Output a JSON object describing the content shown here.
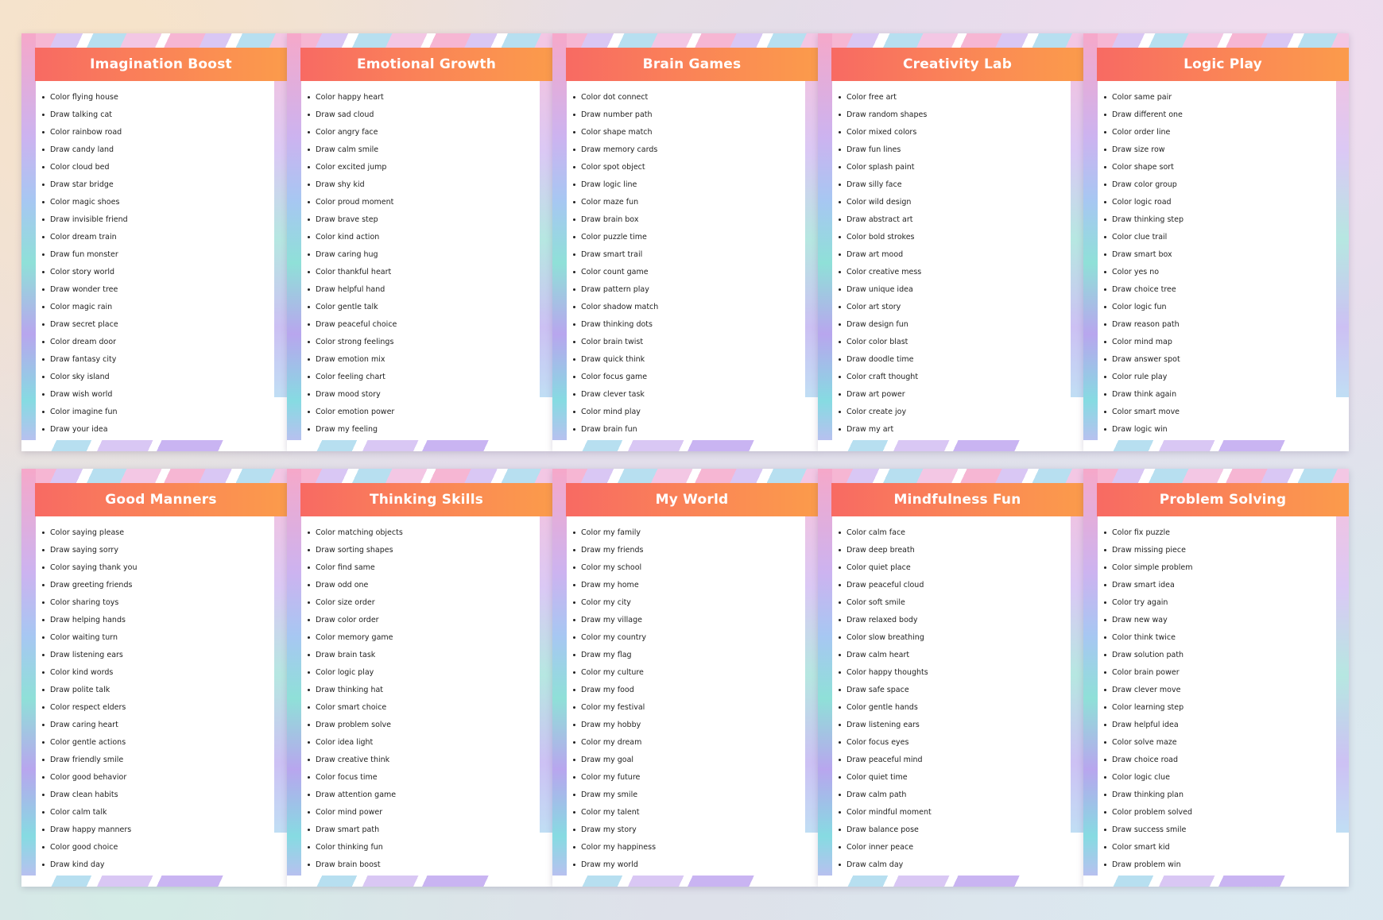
{
  "pages": [
    {
      "title": "Imagination Boost",
      "items": [
        "Color flying house",
        "Draw talking cat",
        "Color rainbow road",
        "Draw candy land",
        "Color cloud bed",
        "Draw star bridge",
        "Color magic shoes",
        "Draw invisible friend",
        "Color dream train",
        "Draw fun monster",
        "Color story world",
        "Draw wonder tree",
        "Color magic rain",
        "Draw secret place",
        "Color dream door",
        "Draw fantasy city",
        "Color sky island",
        "Draw wish world",
        "Color imagine fun",
        "Draw your idea"
      ]
    },
    {
      "title": "Emotional Growth",
      "items": [
        "Color happy heart",
        "Draw sad cloud",
        "Color angry face",
        "Draw calm smile",
        "Color excited jump",
        "Draw shy kid",
        "Color proud moment",
        "Draw brave step",
        "Color kind action",
        "Draw caring hug",
        "Color thankful heart",
        "Draw helpful hand",
        "Color gentle talk",
        "Draw peaceful choice",
        "Color strong feelings",
        "Draw emotion mix",
        "Color feeling chart",
        "Draw mood story",
        "Color emotion power",
        "Draw my feeling"
      ]
    },
    {
      "title": "Brain Games",
      "items": [
        "Color dot connect",
        "Draw number path",
        "Color shape match",
        "Draw memory cards",
        "Color spot object",
        "Draw logic line",
        "Color maze fun",
        "Draw brain box",
        "Color puzzle time",
        "Draw smart trail",
        "Color count game",
        "Draw pattern play",
        "Color shadow match",
        "Draw thinking dots",
        "Color brain twist",
        "Draw quick think",
        "Color focus game",
        "Draw clever task",
        "Color mind play",
        "Draw brain fun"
      ]
    },
    {
      "title": "Creativity Lab",
      "items": [
        "Color free art",
        "Draw random shapes",
        "Color mixed colors",
        "Draw fun lines",
        "Color splash paint",
        "Draw silly face",
        "Color wild design",
        "Draw abstract art",
        "Color bold strokes",
        "Draw art mood",
        "Color creative mess",
        "Draw unique idea",
        "Color art story",
        "Draw design fun",
        "Color color blast",
        "Draw doodle time",
        "Color craft thought",
        "Draw art power",
        "Color create joy",
        "Draw my art"
      ]
    },
    {
      "title": "Logic Play",
      "items": [
        "Color same pair",
        "Draw different one",
        "Color order line",
        "Draw size row",
        "Color shape sort",
        "Draw color group",
        "Color logic road",
        "Draw thinking step",
        "Color clue trail",
        "Draw smart box",
        "Color yes no",
        "Draw choice tree",
        "Color logic fun",
        "Draw reason path",
        "Color mind map",
        "Draw answer spot",
        "Color rule play",
        "Draw think again",
        "Color smart move",
        "Draw logic win"
      ]
    },
    {
      "title": "Good Manners",
      "items": [
        "Color saying please",
        "Draw saying sorry",
        "Color saying thank you",
        "Draw greeting friends",
        "Color sharing toys",
        "Draw helping hands",
        "Color waiting turn",
        "Draw listening ears",
        "Color kind words",
        "Draw polite talk",
        "Color respect elders",
        "Draw caring heart",
        "Color gentle actions",
        "Draw friendly smile",
        "Color good behavior",
        "Draw clean habits",
        "Color calm talk",
        "Draw happy manners",
        "Color good choice",
        "Draw kind day"
      ]
    },
    {
      "title": "Thinking Skills",
      "items": [
        "Color matching objects",
        "Draw sorting shapes",
        "Color find same",
        "Draw odd one",
        "Color size order",
        "Draw color order",
        "Color memory game",
        "Draw brain task",
        "Color logic play",
        "Draw thinking hat",
        "Color smart choice",
        "Draw problem solve",
        "Color idea light",
        "Draw creative think",
        "Color focus time",
        "Draw attention game",
        "Color mind power",
        "Draw smart path",
        "Color thinking fun",
        "Draw brain boost"
      ]
    },
    {
      "title": "My World",
      "items": [
        "Color my family",
        "Draw my friends",
        "Color my school",
        "Draw my home",
        "Color my city",
        "Draw my village",
        "Color my country",
        "Draw my flag",
        "Color my culture",
        "Draw my food",
        "Color my festival",
        "Draw my hobby",
        "Color my dream",
        "Draw my goal",
        "Color my future",
        "Draw my smile",
        "Color my talent",
        "Draw my story",
        "Color my happiness",
        "Draw my world"
      ]
    },
    {
      "title": "Mindfulness Fun",
      "items": [
        "Color calm face",
        "Draw deep breath",
        "Color quiet place",
        "Draw peaceful cloud",
        "Color soft smile",
        "Draw relaxed body",
        "Color slow breathing",
        "Draw calm heart",
        "Color happy thoughts",
        "Draw safe space",
        "Color gentle hands",
        "Draw listening ears",
        "Color focus eyes",
        "Draw peaceful mind",
        "Color quiet time",
        "Draw calm path",
        "Color mindful moment",
        "Draw balance pose",
        "Color inner peace",
        "Draw calm day"
      ]
    },
    {
      "title": "Problem Solving",
      "items": [
        "Color fix puzzle",
        "Draw missing piece",
        "Color simple problem",
        "Draw smart idea",
        "Color try again",
        "Draw new way",
        "Color think twice",
        "Draw solution path",
        "Color brain power",
        "Draw clever move",
        "Color learning step",
        "Draw helpful idea",
        "Color solve maze",
        "Draw choice road",
        "Color logic clue",
        "Draw thinking plan",
        "Color problem solved",
        "Draw success smile",
        "Color smart kid",
        "Draw problem win"
      ]
    }
  ]
}
